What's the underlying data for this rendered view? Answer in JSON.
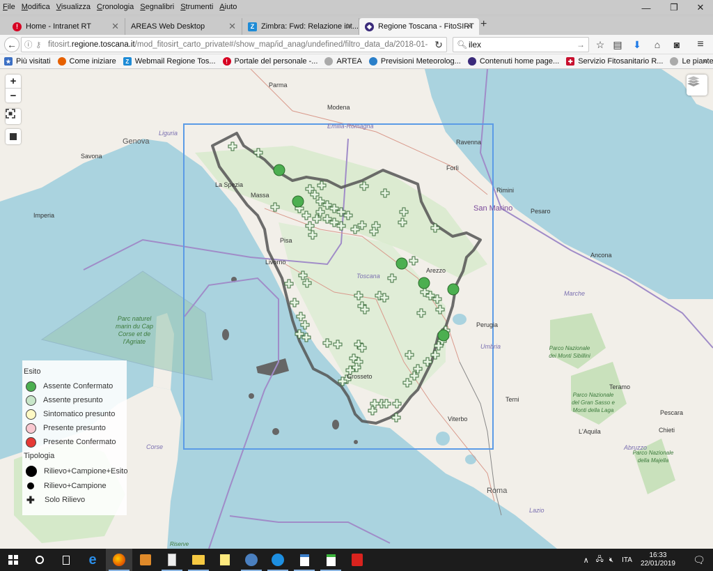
{
  "menubar": {
    "items": [
      "File",
      "Modifica",
      "Visualizza",
      "Cronologia",
      "Segnalibri",
      "Strumenti",
      "Aiuto"
    ]
  },
  "window_controls": {
    "minimize": "—",
    "restore": "❐",
    "close": "✕"
  },
  "tabs": [
    {
      "label": "Home - Intranet RT",
      "icon": "alert-icon",
      "color": "#d70022",
      "glyph": "!"
    },
    {
      "label": "AREAS Web Desktop",
      "icon": "",
      "color": "",
      "glyph": ""
    },
    {
      "label": "Zimbra: Fwd: Relazione int...",
      "icon": "zimbra-icon",
      "color": "#1e8bd6",
      "glyph": "Z"
    },
    {
      "label": "Regione Toscana - FitoSIRT",
      "icon": "fitosirt-icon",
      "color": "#3a2a7a",
      "glyph": "◆",
      "active": true
    }
  ],
  "newtab_label": "+",
  "url": {
    "prefix": "fitosirt.",
    "domain": "regione.toscana.it",
    "path": "/mod_fitosirt_carto_private#/show_map/id_anag/undefined/filtro_data_da/2018-01-"
  },
  "search": {
    "value": "ilex"
  },
  "bookmarks": [
    {
      "label": "Più visitati",
      "color": "#3b6fc4",
      "glyph": "★"
    },
    {
      "label": "Come iniziare",
      "color": "#e66000",
      "glyph": "●"
    },
    {
      "label": "Webmail Regione Tos...",
      "color": "#1e8bd6",
      "glyph": "Z"
    },
    {
      "label": "Portale del personale -...",
      "color": "#d70022",
      "glyph": "!"
    },
    {
      "label": "ARTEA",
      "color": "#999999",
      "glyph": "◎"
    },
    {
      "label": "Previsioni Meteorolog...",
      "color": "#2a7fc9",
      "glyph": "◎"
    },
    {
      "label": "Contenuti home page...",
      "color": "#3a2a7a",
      "glyph": "◆"
    },
    {
      "label": "Servizio Fitosanitario R...",
      "color": "#c8102e",
      "glyph": "✚"
    },
    {
      "label": "Le piante geneticame...",
      "color": "#999999",
      "glyph": "◎"
    }
  ],
  "bookmarks_overflow": "»",
  "map": {
    "zoom_in": "+",
    "zoom_out": "−",
    "labels": [
      {
        "text": "Parma",
        "type": "city"
      },
      {
        "text": "Modena",
        "type": "city"
      },
      {
        "text": "Emilia-Romagna",
        "type": "region"
      },
      {
        "text": "Genova",
        "type": "big"
      },
      {
        "text": "Savona",
        "type": "city"
      },
      {
        "text": "Liguria",
        "type": "region"
      },
      {
        "text": "La Spezia",
        "type": "city"
      },
      {
        "text": "Massa",
        "type": "city"
      },
      {
        "text": "Imperia",
        "type": "city"
      },
      {
        "text": "Pisa",
        "type": "city"
      },
      {
        "text": "Livorno",
        "type": "city"
      },
      {
        "text": "Toscana",
        "type": "region"
      },
      {
        "text": "Arezzo",
        "type": "city"
      },
      {
        "text": "Ravenna",
        "type": "city"
      },
      {
        "text": "Forlì",
        "type": "city"
      },
      {
        "text": "Rimini",
        "type": "city"
      },
      {
        "text": "San Marino",
        "type": "country"
      },
      {
        "text": "Pesaro",
        "type": "city"
      },
      {
        "text": "Ancona",
        "type": "city"
      },
      {
        "text": "Marche",
        "type": "region"
      },
      {
        "text": "Perugia",
        "type": "city"
      },
      {
        "text": "Umbria",
        "type": "region"
      },
      {
        "text": "Grosseto",
        "type": "city"
      },
      {
        "text": "Terni",
        "type": "city"
      },
      {
        "text": "Viterbo",
        "type": "city"
      },
      {
        "text": "Roma",
        "type": "big"
      },
      {
        "text": "Teramo",
        "type": "city"
      },
      {
        "text": "Pescara",
        "type": "city"
      },
      {
        "text": "Chieti",
        "type": "city"
      },
      {
        "text": "L'Aquila",
        "type": "city"
      },
      {
        "text": "Abruzzo",
        "type": "region"
      },
      {
        "text": "Lazio",
        "type": "region"
      },
      {
        "text": "Corse",
        "type": "region"
      },
      {
        "text": "Parc naturel marin du Cap Corse et de l'Agriate",
        "type": "park"
      },
      {
        "text": "Parco Nazionale dei Monti Sibillini",
        "type": "park"
      },
      {
        "text": "Parco Nazionale del Gran Sasso e Monti della Laga",
        "type": "park"
      },
      {
        "text": "Parco Nazionale della Majella",
        "type": "park"
      },
      {
        "text": "Riserve",
        "type": "park"
      }
    ]
  },
  "legend": {
    "esito_title": "Esito",
    "esito": [
      {
        "label": "Assente Confermato",
        "color": "#4caf50"
      },
      {
        "label": "Assente presunto",
        "color": "#c8e6c9"
      },
      {
        "label": "Sintomatico presunto",
        "color": "#fff9c4"
      },
      {
        "label": "Presente presunto",
        "color": "#f8c8d0"
      },
      {
        "label": "Presente Confermato",
        "color": "#e53935"
      }
    ],
    "tipologia_title": "Tipologia",
    "tipologia": [
      {
        "label": "Rilievo+Campione+Esito",
        "symbol": "large-dot"
      },
      {
        "label": "Rilievo+Campione",
        "symbol": "small-dot"
      },
      {
        "label": "Solo Rilievo",
        "symbol": "cross"
      }
    ]
  },
  "taskbar": {
    "apps": [
      "start",
      "cortana",
      "task-view",
      "edge",
      "firefox",
      "media",
      "calculator",
      "file-explorer",
      "sticky-notes",
      "thunderbird",
      "teamviewer",
      "writer",
      "calc",
      "acrobat"
    ],
    "tray": {
      "language": "ITA",
      "time": "16:33",
      "date": "22/01/2019"
    }
  }
}
